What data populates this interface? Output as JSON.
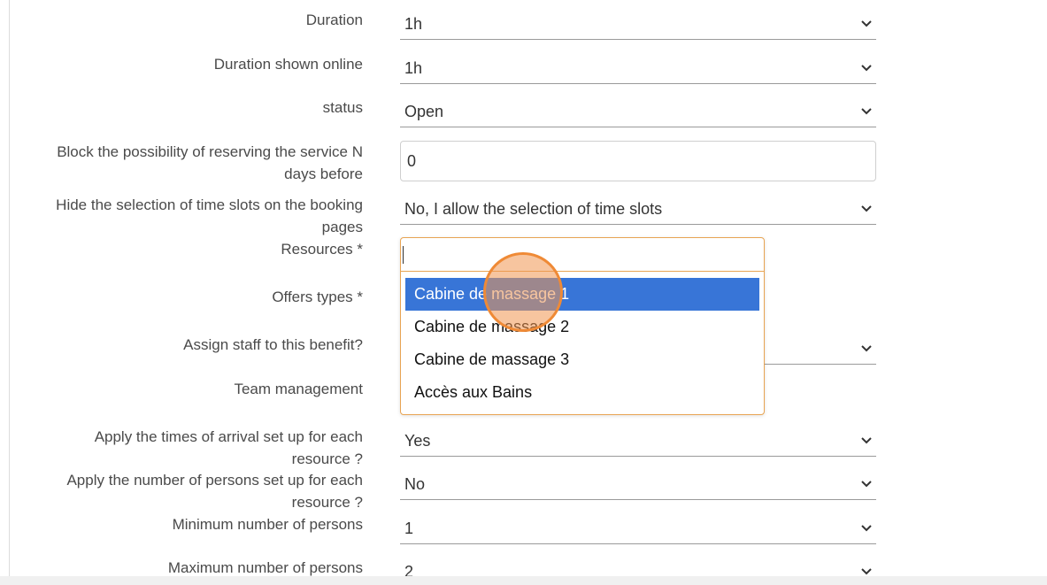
{
  "form": {
    "duration": {
      "label": "Duration",
      "value": "1h"
    },
    "duration_online": {
      "label": "Duration shown online",
      "value": "1h"
    },
    "status": {
      "label": "status",
      "value": "Open"
    },
    "block_days": {
      "label_line1": "Block the possibility of reserving the service N",
      "label_line2": "days before",
      "value": "0"
    },
    "hide_slots": {
      "label_line1": "Hide the selection of time slots on the booking",
      "label_line2": "pages",
      "value": "No, I allow the selection of time slots"
    },
    "resources": {
      "label": "Resources *",
      "search_value": ""
    },
    "offers_types": {
      "label": "Offers types *"
    },
    "assign_staff": {
      "label": "Assign staff to this benefit?"
    },
    "team_management": {
      "label": "Team management"
    },
    "apply_arrival": {
      "label_line1": "Apply the times of arrival set up for each",
      "label_line2": "resource ?",
      "value": "Yes"
    },
    "apply_persons": {
      "label_line1": "Apply the number of persons set up for each",
      "label_line2": "resource ?",
      "value": "No"
    },
    "min_persons": {
      "label": "Minimum number of persons",
      "value": "1"
    },
    "max_persons": {
      "label": "Maximum number of persons",
      "value": "2"
    }
  },
  "dropdown": {
    "options": [
      "Cabine de massage 1",
      "Cabine de massage 2",
      "Cabine de massage 3",
      "Accès aux Bains"
    ],
    "highlighted_index": 0
  },
  "colors": {
    "highlight": "#3875d7",
    "focus_border": "#e8a453",
    "cursor_marker": "#ef8a36"
  },
  "icons": {
    "select_arrow": "chevron-down-icon"
  }
}
